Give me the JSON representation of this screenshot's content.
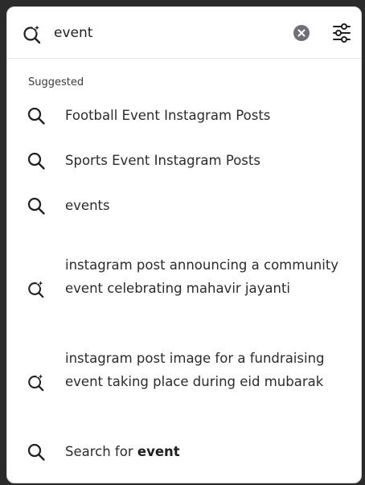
{
  "search": {
    "value": "event",
    "icon": "ai-sparkle-search-icon"
  },
  "controls": {
    "clear_icon": "clear-circle-icon",
    "filter_icon": "filter-sliders-icon"
  },
  "suggestions": {
    "section_label": "Suggested",
    "items": [
      {
        "type": "search",
        "icon": "search-icon",
        "text": "Football Event Instagram Posts"
      },
      {
        "type": "search",
        "icon": "search-icon",
        "text": "Sports Event Instagram Posts"
      },
      {
        "type": "search",
        "icon": "search-icon",
        "text": "events"
      },
      {
        "type": "ai",
        "icon": "ai-sparkle-search-icon",
        "text": "instagram post announcing a community event celebrating mahavir jayanti"
      },
      {
        "type": "ai",
        "icon": "ai-sparkle-search-icon",
        "text": "instagram post image for a fundraising event taking place during eid mubarak"
      }
    ],
    "search_for": {
      "icon": "search-icon",
      "prefix": "Search for ",
      "term": "event"
    }
  },
  "colors": {
    "text": "#2b2b2b",
    "icon": "#1f1f1f",
    "clear_button": "#6f6f75",
    "divider": "#e4e4e4"
  }
}
